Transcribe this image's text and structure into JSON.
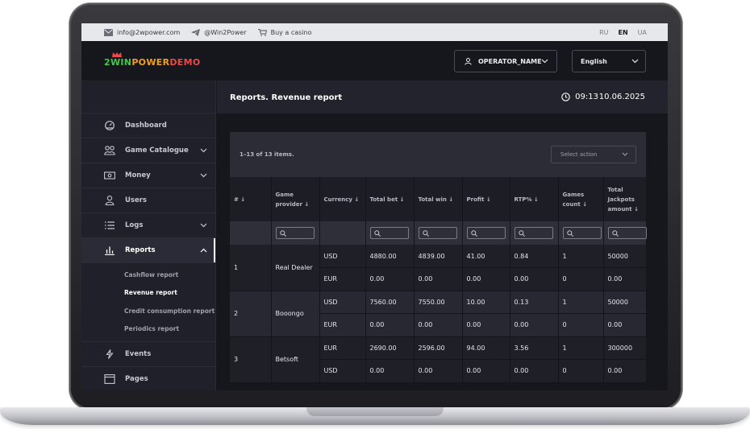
{
  "topbar": {
    "email": "info@2wpower.com",
    "telegram": "@Win2Power",
    "buy": "Buy a casino",
    "langs": [
      "RU",
      "EN",
      "UA"
    ],
    "active_lang": "EN"
  },
  "header": {
    "logo_parts": [
      "2",
      "WIN",
      "POWER",
      "DEMO"
    ],
    "operator": "OPERATOR_NAME",
    "language": "English"
  },
  "sidebar": {
    "items": [
      {
        "label": "Dashboard",
        "icon": "dashboard-icon"
      },
      {
        "label": "Game Catalogue",
        "icon": "game-catalogue-icon",
        "expandable": true
      },
      {
        "label": "Money",
        "icon": "money-icon",
        "expandable": true
      },
      {
        "label": "Users",
        "icon": "user-icon"
      },
      {
        "label": "Logs",
        "icon": "list-icon",
        "expandable": true
      },
      {
        "label": "Reports",
        "icon": "chart-icon",
        "expandable": true,
        "expanded": true
      }
    ],
    "reports_sub": [
      "Cashflow report",
      "Revenue report",
      "Credit consumption report",
      "Periodics report"
    ],
    "active_sub": "Revenue report",
    "bottom_items": [
      {
        "label": "Events",
        "icon": "lightning-icon"
      },
      {
        "label": "Pages",
        "icon": "pages-icon"
      }
    ]
  },
  "main": {
    "title": "Reports.  Revenue report",
    "time": "09:13",
    "date": "10.06.2025",
    "items_count": "1–13 of 13 items.",
    "select_action": "Select action"
  },
  "table": {
    "columns": [
      "#",
      "Game provider",
      "Currency",
      "Total bet",
      "Total win",
      "Profit",
      "RTP%",
      "Games count",
      "Total Jackpots amount"
    ],
    "groups": [
      {
        "num": "1",
        "provider": "Real Dealer",
        "rows": [
          {
            "currency": "USD",
            "total_bet": "4880.00",
            "total_win": "4839.00",
            "profit": "41.00",
            "rtp": "0.84",
            "games": "1",
            "jackpots": "50000"
          },
          {
            "currency": "EUR",
            "total_bet": "0.00",
            "total_win": "0.00",
            "profit": "0.00",
            "rtp": "0.00",
            "games": "0",
            "jackpots": "0.00"
          }
        ]
      },
      {
        "num": "2",
        "provider": "Booongo",
        "rows": [
          {
            "currency": "USD",
            "total_bet": "7560.00",
            "total_win": "7550.00",
            "profit": "10.00",
            "rtp": "0.13",
            "games": "1",
            "jackpots": "50000"
          },
          {
            "currency": "EUR",
            "total_bet": "0.00",
            "total_win": "0.00",
            "profit": "0.00",
            "rtp": "0.00",
            "games": "0",
            "jackpots": "0.00"
          }
        ]
      },
      {
        "num": "3",
        "provider": "Betsoft",
        "rows": [
          {
            "currency": "EUR",
            "total_bet": "2690.00",
            "total_win": "2596.00",
            "profit": "94.00",
            "rtp": "3.56",
            "games": "1",
            "jackpots": "300000"
          },
          {
            "currency": "USD",
            "total_bet": "0.00",
            "total_win": "0.00",
            "profit": "0.00",
            "rtp": "0.00",
            "games": "0",
            "jackpots": "0.00"
          }
        ]
      }
    ]
  }
}
